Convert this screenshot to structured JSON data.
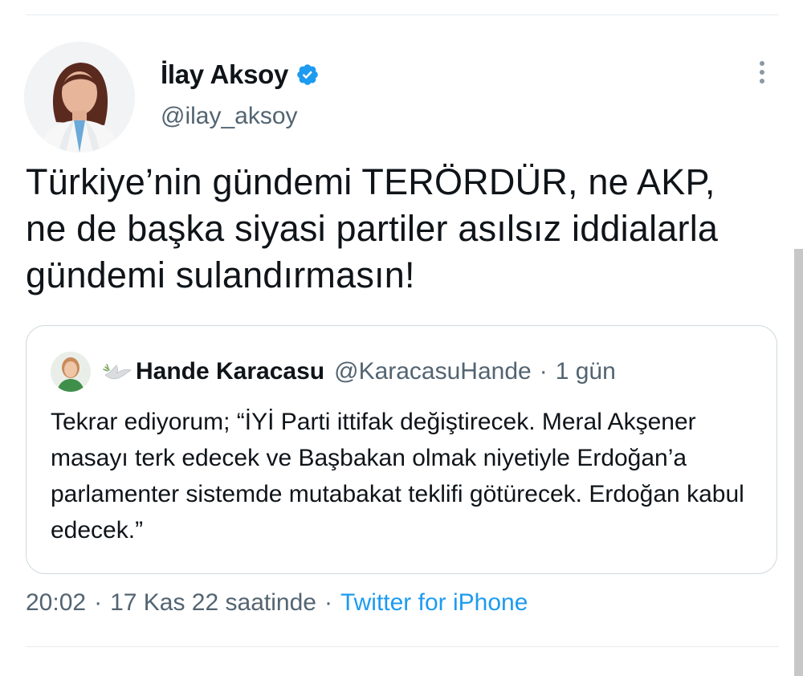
{
  "tweet": {
    "author": {
      "display_name": "İlay Aksoy",
      "handle": "@ilay_aksoy",
      "verified": true
    },
    "text": "Türkiye’nin gündemi TERÖRDÜR, ne AKP, ne de başka siyasi partiler asılsız iddialarla gündemi sulandırmasın!",
    "quoted_tweet": {
      "author": {
        "display_name": "Hande Karacasu",
        "handle": "@KaracasuHande"
      },
      "separator": "·",
      "time_ago": "1 gün",
      "text": "Tekrar ediyorum; “İYİ Parti ittifak değiştirecek. Meral Akşener masayı terk edecek ve Başbakan olmak niyetiyle Erdoğan’a parlamenter sistemde mutabakat teklifi götürecek. Erdoğan kabul edecek.”"
    },
    "meta": {
      "time": "20:02",
      "separator": "·",
      "date": "17 Kas 22 saatinde",
      "source": "Twitter for iPhone"
    }
  },
  "icons": {
    "verified": "verified-badge-icon",
    "more": "more-vertical-icon",
    "dove": "dove-icon"
  },
  "colors": {
    "link": "#1d9bf0",
    "secondary_text": "#536471",
    "border": "#cfd9de",
    "verified": "#1d9bf0"
  }
}
